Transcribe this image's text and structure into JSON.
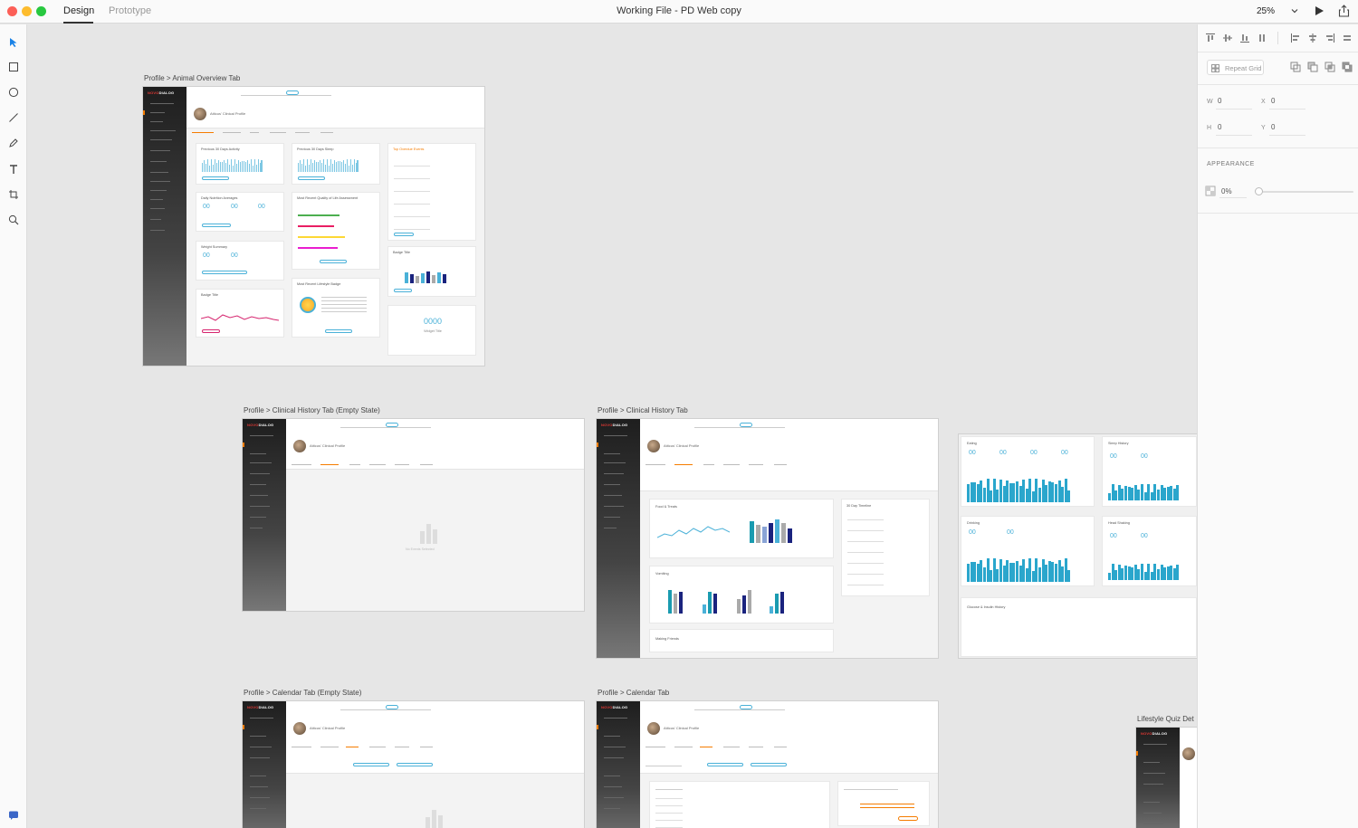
{
  "titlebar": {
    "tabs": [
      "Design",
      "Prototype"
    ],
    "title": "Working File - PD Web copy",
    "zoom": "25%"
  },
  "tools": [
    "select-icon",
    "rectangle-icon",
    "ellipse-icon",
    "line-icon",
    "pen-icon",
    "text-icon",
    "artboard-icon",
    "zoom-icon"
  ],
  "artboards": {
    "animal_overview": "Profile > Animal Overview Tab",
    "clinical_empty": "Profile > Clinical History Tab (Empty State)",
    "clinical": "Profile > Clinical History Tab",
    "calendar_empty": "Profile > Calendar Tab (Empty State)",
    "calendar": "Profile > Calendar Tab",
    "lifestyle": "Lifestyle Quiz Det"
  },
  "mock": {
    "brand_a": "NOVO",
    "brand_b": "DIALOG",
    "profile_title": "Atticus' Clinical Profile",
    "overview_cards": {
      "activity": "Previous 30 Days Activity",
      "sleep": "Previous 30 Days Sleep",
      "overdue": "Top Overdue Events",
      "nutrition": "Daily Nutrition Averages",
      "quality": "Most Recent Quality of Life Assessment",
      "weight": "Weight Summary",
      "badge_a": "Badge Title",
      "badge_b": "Badge Title",
      "lifestyle": "Most Recent Lifestyle Badge",
      "count": "0000",
      "count_label": "Widget Title",
      "nums": "00"
    },
    "clinical_cards": {
      "food": "Food & Treats",
      "timeline": "30 Day Timeline",
      "vomiting": "Vomiting",
      "making": "Making Friends",
      "empty": "No Events Selected"
    },
    "history_cards": {
      "eating": "Eating",
      "sleep": "Sleep History",
      "drinking": "Drinking",
      "head": "Head Shaking",
      "glucose": "Glucose & Insulin History"
    }
  },
  "panel": {
    "repeat_grid": "Repeat Grid",
    "w_label": "W",
    "w_value": "0",
    "x_label": "X",
    "x_value": "0",
    "h_label": "H",
    "h_value": "0",
    "y_label": "Y",
    "y_value": "0",
    "appearance": "APPEARANCE",
    "opacity": "0%"
  },
  "colors": {
    "accent": "#4ab1d8",
    "brand": "#e53935",
    "active": "#f57c00"
  }
}
